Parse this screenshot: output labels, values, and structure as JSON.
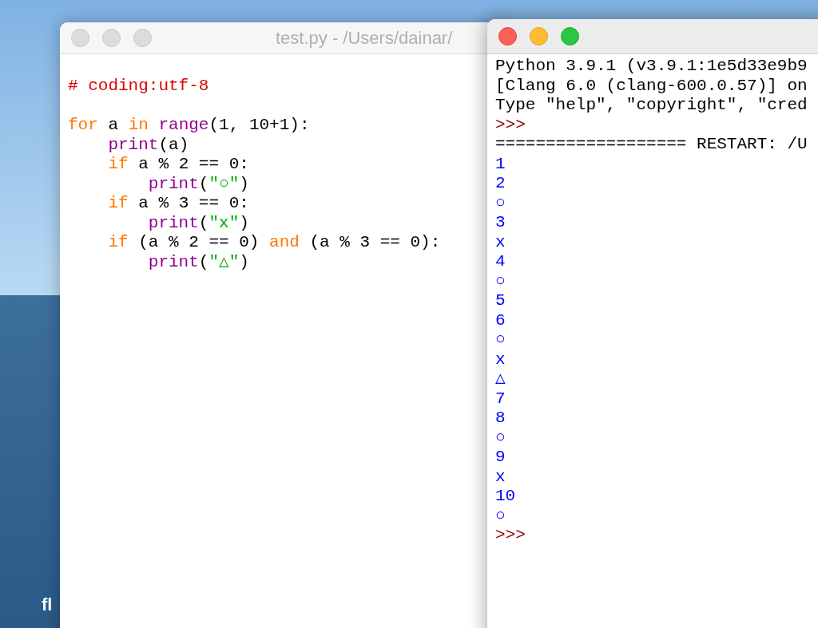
{
  "desktop": {
    "label": "fl"
  },
  "editor": {
    "title": "test.py - /Users/dainar/",
    "active": false,
    "lines": [
      {
        "tokens": [
          {
            "text": "# coding:utf-8",
            "kind": "comment"
          }
        ]
      },
      {
        "blank": true
      },
      {
        "tokens": [
          {
            "text": "for",
            "kind": "keyword"
          },
          {
            "text": " a ",
            "kind": "plain"
          },
          {
            "text": "in",
            "kind": "keyword"
          },
          {
            "text": " range",
            "kind": "builtin"
          },
          {
            "text": "(1, 10+1):",
            "kind": "plain"
          }
        ]
      },
      {
        "tokens": [
          {
            "text": "    print",
            "kind": "builtin"
          },
          {
            "text": "(a)",
            "kind": "plain"
          }
        ]
      },
      {
        "tokens": [
          {
            "text": "    if",
            "kind": "keyword"
          },
          {
            "text": " a % 2 == 0:",
            "kind": "plain"
          }
        ]
      },
      {
        "tokens": [
          {
            "text": "        print",
            "kind": "builtin"
          },
          {
            "text": "(",
            "kind": "plain"
          },
          {
            "text": "\"○\"",
            "kind": "string"
          },
          {
            "text": ")",
            "kind": "plain"
          }
        ]
      },
      {
        "tokens": [
          {
            "text": "    if",
            "kind": "keyword"
          },
          {
            "text": " a % 3 == 0:",
            "kind": "plain"
          }
        ]
      },
      {
        "tokens": [
          {
            "text": "        print",
            "kind": "builtin"
          },
          {
            "text": "(",
            "kind": "plain"
          },
          {
            "text": "\"x\"",
            "kind": "string"
          },
          {
            "text": ")",
            "kind": "plain"
          }
        ]
      },
      {
        "tokens": [
          {
            "text": "    if",
            "kind": "keyword"
          },
          {
            "text": " (a % 2 == 0) ",
            "kind": "plain"
          },
          {
            "text": "and",
            "kind": "keyword"
          },
          {
            "text": " (a % 3 == 0):",
            "kind": "plain"
          }
        ]
      },
      {
        "tokens": [
          {
            "text": "        print",
            "kind": "builtin"
          },
          {
            "text": "(",
            "kind": "plain"
          },
          {
            "text": "\"△\"",
            "kind": "string"
          },
          {
            "text": ")",
            "kind": "plain"
          }
        ]
      }
    ]
  },
  "shell": {
    "active": true,
    "lines": [
      {
        "text": "Python 3.9.1 (v3.9.1:1e5d33e9b9",
        "kind": "banner"
      },
      {
        "text": "[Clang 6.0 (clang-600.0.57)] on",
        "kind": "banner"
      },
      {
        "text": "Type \"help\", \"copyright\", \"cred",
        "kind": "banner"
      },
      {
        "text": ">>>",
        "kind": "prompt"
      },
      {
        "text": "=================== RESTART: /U",
        "kind": "banner"
      },
      {
        "text": "1",
        "kind": "output"
      },
      {
        "text": "2",
        "kind": "output"
      },
      {
        "text": "○",
        "kind": "output"
      },
      {
        "text": "3",
        "kind": "output"
      },
      {
        "text": "x",
        "kind": "output"
      },
      {
        "text": "4",
        "kind": "output"
      },
      {
        "text": "○",
        "kind": "output"
      },
      {
        "text": "5",
        "kind": "output"
      },
      {
        "text": "6",
        "kind": "output"
      },
      {
        "text": "○",
        "kind": "output"
      },
      {
        "text": "x",
        "kind": "output"
      },
      {
        "text": "△",
        "kind": "output"
      },
      {
        "text": "7",
        "kind": "output"
      },
      {
        "text": "8",
        "kind": "output"
      },
      {
        "text": "○",
        "kind": "output"
      },
      {
        "text": "9",
        "kind": "output"
      },
      {
        "text": "x",
        "kind": "output"
      },
      {
        "text": "10",
        "kind": "output"
      },
      {
        "text": "○",
        "kind": "output"
      },
      {
        "text": ">>>",
        "kind": "prompt"
      }
    ]
  }
}
